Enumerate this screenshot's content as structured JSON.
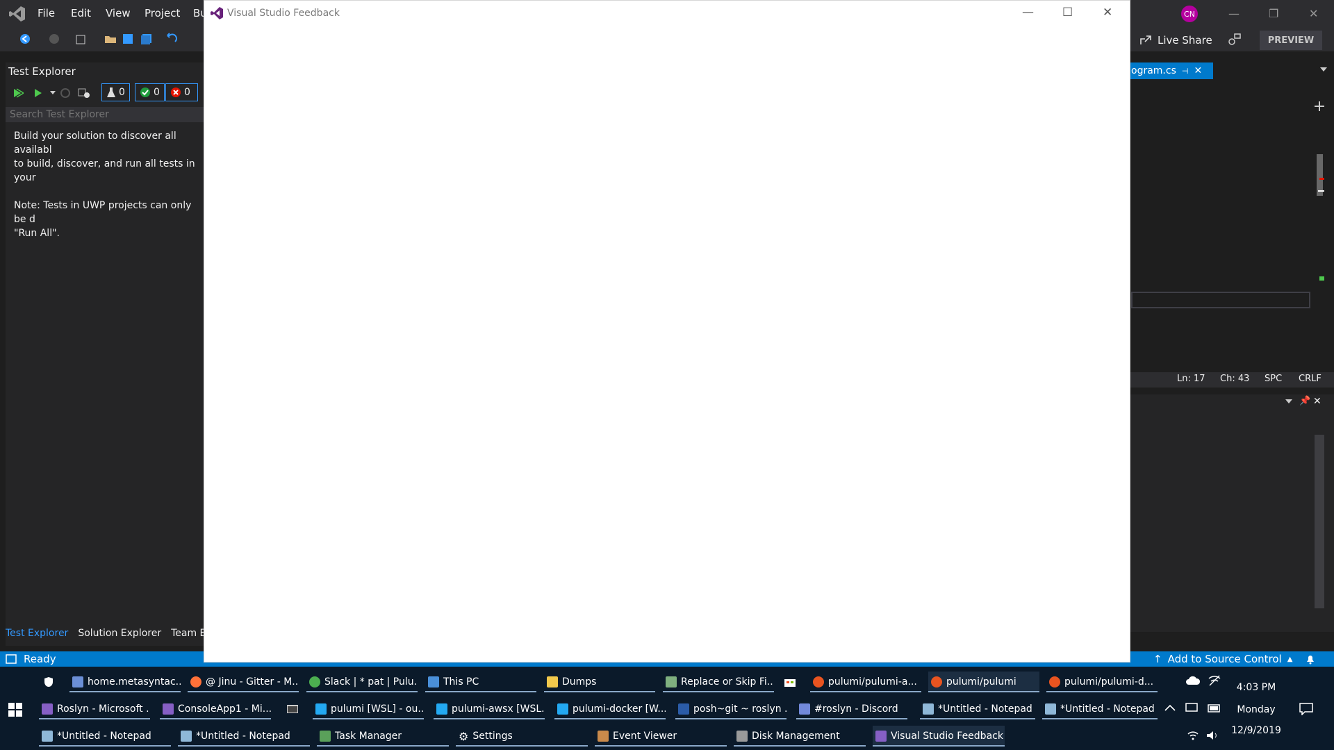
{
  "vs": {
    "menu": [
      "File",
      "Edit",
      "View",
      "Project",
      "Bu"
    ],
    "avatar": "CN",
    "live_share": "Live Share",
    "preview": "PREVIEW"
  },
  "test_explorer": {
    "title": "Test Explorer",
    "counts": {
      "total": "0",
      "passed": "0",
      "failed": "0"
    },
    "search_placeholder": "Search Test Explorer",
    "message": "Build your solution to discover all availabl\nto build, discover, and run all tests in your\n\nNote: Tests in UWP projects can only be d\n\"Run All\"."
  },
  "bottom_tabs": [
    "Test Explorer",
    "Solution Explorer",
    "Team Ex"
  ],
  "editor": {
    "tab": "ogram.cs",
    "status": {
      "ln": "Ln: 17",
      "ch": "Ch: 43",
      "spc": "SPC",
      "crlf": "CRLF"
    }
  },
  "status_bar": {
    "ready": "Ready",
    "source_control": "Add to Source Control"
  },
  "feedback_window": {
    "title": "Visual Studio Feedback"
  },
  "taskbar": {
    "row1": [
      "home.metasyntac...",
      "@ Jinu - Gitter - M...",
      "Slack | * pat | Pulu...",
      "This PC",
      "Dumps",
      "Replace or Skip Fi...",
      "pulumi/pulumi-a...",
      "pulumi/pulumi",
      "pulumi/pulumi-d..."
    ],
    "row2": [
      "Roslyn - Microsoft ...",
      "ConsoleApp1 - Mi...",
      "pulumi [WSL] - ou...",
      "pulumi-awsx [WSL...",
      "pulumi-docker [W...",
      "posh~git ~ roslyn ...",
      "#roslyn - Discord",
      "*Untitled - Notepad",
      "*Untitled - Notepad"
    ],
    "row3": [
      "*Untitled - Notepad",
      "*Untitled - Notepad",
      "Task Manager",
      "Settings",
      "Event Viewer",
      "Disk Management",
      "Visual Studio Feedback"
    ],
    "clock": {
      "time": "4:03 PM",
      "day": "Monday",
      "date": "12/9/2019"
    }
  },
  "colors": {
    "accent": "#007acc",
    "vs_purple": "#68217a",
    "avatar": "#b4009e"
  }
}
